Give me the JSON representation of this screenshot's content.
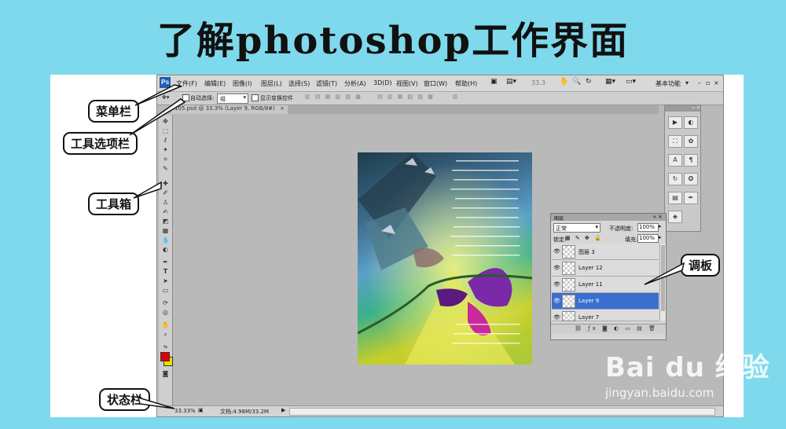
{
  "page_title": "了解photoshop工作界面",
  "menubar": {
    "logo": "Ps",
    "items": [
      "文件(F)",
      "编辑(E)",
      "图像(I)",
      "图层(L)",
      "选择(S)",
      "滤镜(T)",
      "分析(A)",
      "3D(D)",
      "视图(V)",
      "窗口(W)",
      "帮助(H)"
    ],
    "zoom": "33.3",
    "workspace": "基本功能"
  },
  "options_bar": {
    "auto_select_label": "自动选择:",
    "auto_select_value": "组",
    "show_transform_label": "显示变换控件"
  },
  "document_tab": {
    "label": "105.psd @ 33.3% (Layer 9, RGB/8#)"
  },
  "status_bar": {
    "zoom": "33.33%",
    "doc_info": "文档:4.98M/33.2M"
  },
  "layers_panel": {
    "tab": "图层",
    "blend_mode": "正常",
    "opacity_label": "不透明度:",
    "opacity_value": "100%",
    "lock_label": "锁定:",
    "fill_label": "填充:",
    "fill_value": "100%",
    "layers": [
      {
        "name": "图层 3",
        "selected": false
      },
      {
        "name": "Layer 12",
        "selected": false
      },
      {
        "name": "Layer 11",
        "selected": false
      },
      {
        "name": "Layer 9",
        "selected": true
      },
      {
        "name": "Layer 7",
        "selected": false
      }
    ]
  },
  "callouts": {
    "menu_bar": "菜单栏",
    "tool_options": "工具选项栏",
    "toolbox": "工具箱",
    "panel": "调板",
    "status_bar": "状态栏"
  },
  "watermark": {
    "brand": "Bai du 经验",
    "url": "jingyan.baidu.com"
  },
  "colors": {
    "background": "#7fd9ec",
    "foreground_color": "#e00000",
    "background_color": "#f0e000",
    "selected_layer": "#3a6fd0"
  }
}
